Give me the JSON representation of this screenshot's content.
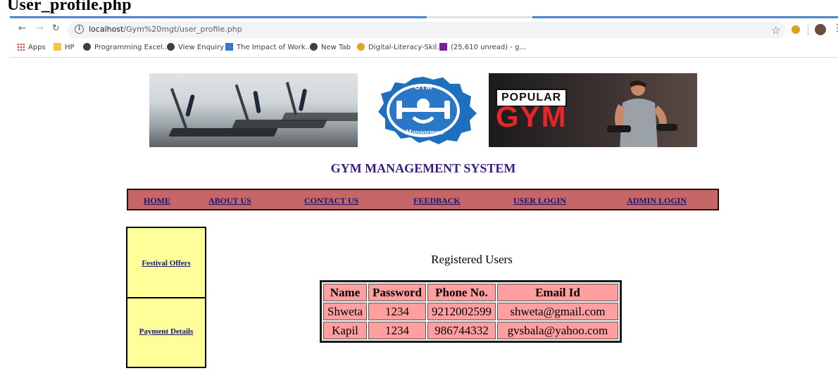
{
  "document_caption": "User_profile.php",
  "browser": {
    "url_host": "localhost",
    "url_path": "/Gym%20mgt/user_profile.php",
    "bookmarks": [
      {
        "label": "Apps",
        "icon": "apps-grid-icon"
      },
      {
        "label": "HP",
        "icon": "folder-icon"
      },
      {
        "label": "Programming Excel...",
        "icon": "globe-icon"
      },
      {
        "label": "View Enquiry",
        "icon": "globe-icon"
      },
      {
        "label": "The Impact of Work...",
        "icon": "bookmark-page-icon"
      },
      {
        "label": "New Tab",
        "icon": "globe-icon"
      },
      {
        "label": "Digital-Literacy-Skil...",
        "icon": "owl-icon"
      },
      {
        "label": "(25,610 unread) - g...",
        "icon": "mail-icon"
      }
    ]
  },
  "header": {
    "logo_top_text": "GYM",
    "logo_bottom_text": "Management",
    "popular_text": "POPULAR",
    "popular_gym_text": "GYM"
  },
  "site": {
    "title": "GYM MANAGEMENT SYSTEM",
    "nav": [
      "HOME",
      "ABOUT US",
      "CONTACT US",
      "FEEDBACK",
      "USER LOGIN",
      "ADMIN LOGIN"
    ]
  },
  "sidebar": {
    "items": [
      "Festival Offers",
      "Payment Details"
    ]
  },
  "users": {
    "title": "Registered Users",
    "columns": [
      "Name",
      "Password",
      "Phone No.",
      "Email Id"
    ],
    "rows": [
      [
        "Shweta",
        "1234",
        "9212002599",
        "shweta@gmail.com"
      ],
      [
        "Kapil",
        "1234",
        "986744332",
        "gvsbala@yahoo.com"
      ]
    ]
  },
  "colors": {
    "nav_bg": "#c76666",
    "title": "#3a1a86",
    "sidebar_bg": "#ffff9a",
    "table_cell": "#ff9f9f"
  }
}
